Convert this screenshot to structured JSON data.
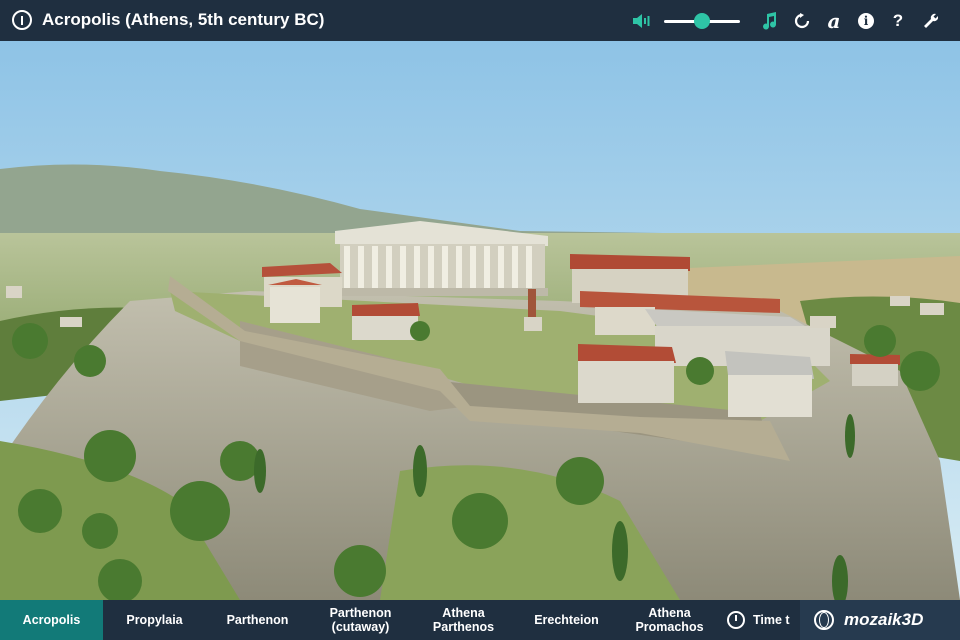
{
  "header": {
    "title": "Acropolis (Athens, 5th century BC)",
    "icons": {
      "power": "power-icon",
      "volume": "volume-icon",
      "music": "music-note-icon",
      "reset": "reset-icon",
      "text_toggle": "letter-a-icon",
      "info": "info-icon",
      "help": "help-icon",
      "settings": "wrench-icon"
    },
    "volume_level": 0.5,
    "help_glyph": "?",
    "text_glyph": "a",
    "info_glyph": "i"
  },
  "tabs": [
    {
      "label": "Acropolis",
      "active": true
    },
    {
      "label": "Propylaia",
      "active": false
    },
    {
      "label": "Parthenon",
      "active": false
    },
    {
      "label": "Parthenon\n(cutaway)",
      "active": false
    },
    {
      "label": "Athena\nParthenos",
      "active": false
    },
    {
      "label": "Erechteion",
      "active": false
    },
    {
      "label": "Athena\nPromachos",
      "active": false
    }
  ],
  "time_button": {
    "label": "Time t",
    "icon": "time-icon"
  },
  "brand": {
    "name": "mozaik3D",
    "icon": "globe-icon"
  },
  "colors": {
    "accent": "#2ec4a6",
    "bar": "#1f2f40",
    "active_tab": "#127a78"
  }
}
